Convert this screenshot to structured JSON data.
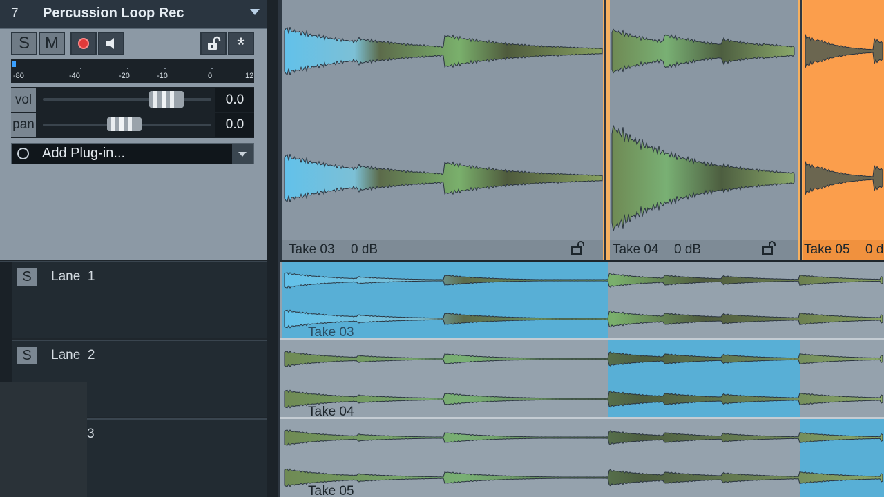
{
  "track": {
    "number": "7",
    "name": "Percussion Loop Rec",
    "buttons": {
      "solo": "S",
      "mute": "M",
      "lock_icon": "lock-open-icon",
      "star": "*"
    },
    "meter_ticks": [
      "-80",
      "-40",
      "-20",
      "-10",
      "0",
      "12"
    ],
    "volume": {
      "label": "vol",
      "value": "0.0",
      "level": 0.75
    },
    "pan": {
      "label": "pan",
      "value": "0.0",
      "level": 0.5
    },
    "plugin": {
      "label": "Add Plug-in..."
    }
  },
  "lanes": [
    {
      "solo": "S",
      "label": "Lane",
      "number": "1"
    },
    {
      "solo": "S",
      "label": "Lane",
      "number": "2"
    },
    {
      "solo": "",
      "label": "",
      "number": "3"
    }
  ],
  "takes": [
    {
      "name": "Take 03",
      "gain": "0 dB"
    },
    {
      "name": "Take 04",
      "gain": "0 dB"
    },
    {
      "name": "Take 05",
      "gain": "0 d"
    }
  ],
  "lane_takes": [
    "Take 03",
    "Take 04",
    "Take 05"
  ],
  "colors": {
    "clip_bg": "#8a97a3",
    "take05_orange": "#fb9e4c",
    "lane_selected": "#58afd6",
    "lane_bg": "#95a2ad",
    "header_bg": "#8c99a5"
  }
}
